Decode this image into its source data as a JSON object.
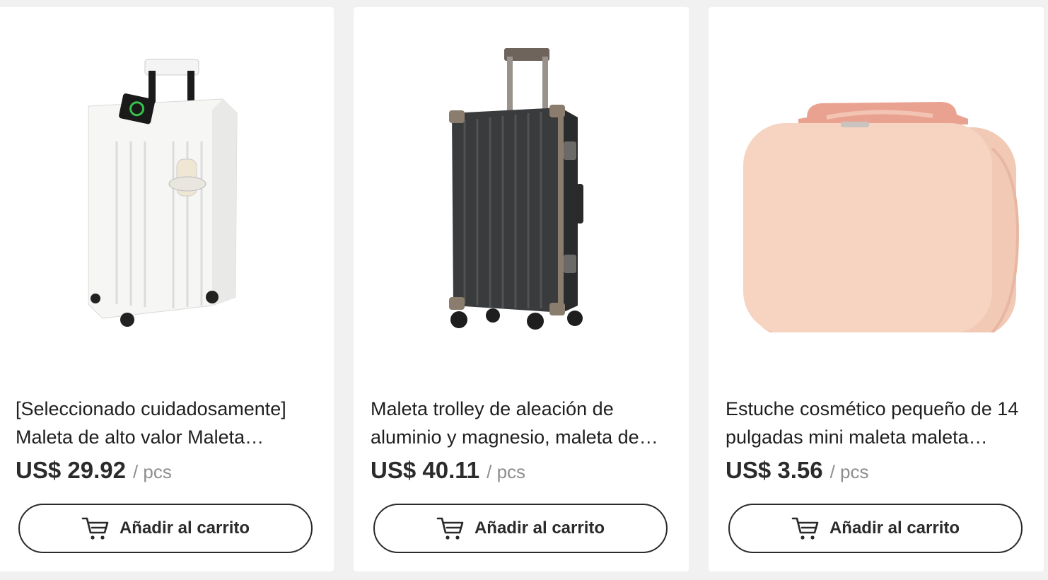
{
  "products": [
    {
      "title": "[Seleccionado cuidadosamente] Maleta de alto valor Maleta…",
      "price": "US$ 29.92",
      "unit": "/ pcs",
      "button_label": "Añadir al carrito",
      "image": "white-suitcase-with-phone-and-cup-holder"
    },
    {
      "title": "Maleta trolley de aleación de aluminio y magnesio, maleta de…",
      "price": "US$ 40.11",
      "unit": "/ pcs",
      "button_label": "Añadir al carrito",
      "image": "black-aluminum-trolley-suitcase"
    },
    {
      "title": "Estuche cosmético pequeño de 14 pulgadas mini maleta maleta…",
      "price": "US$ 3.56",
      "unit": "/ pcs",
      "button_label": "Añadir al carrito",
      "image": "pink-mini-cosmetic-case"
    }
  ],
  "icons": {
    "cart": "shopping-cart-icon"
  },
  "colors": {
    "page_bg": "#f2f1f1",
    "card_bg": "#ffffff",
    "text": "#1f1f1f",
    "muted": "#8e8e8e",
    "border": "#2a2a2a"
  }
}
